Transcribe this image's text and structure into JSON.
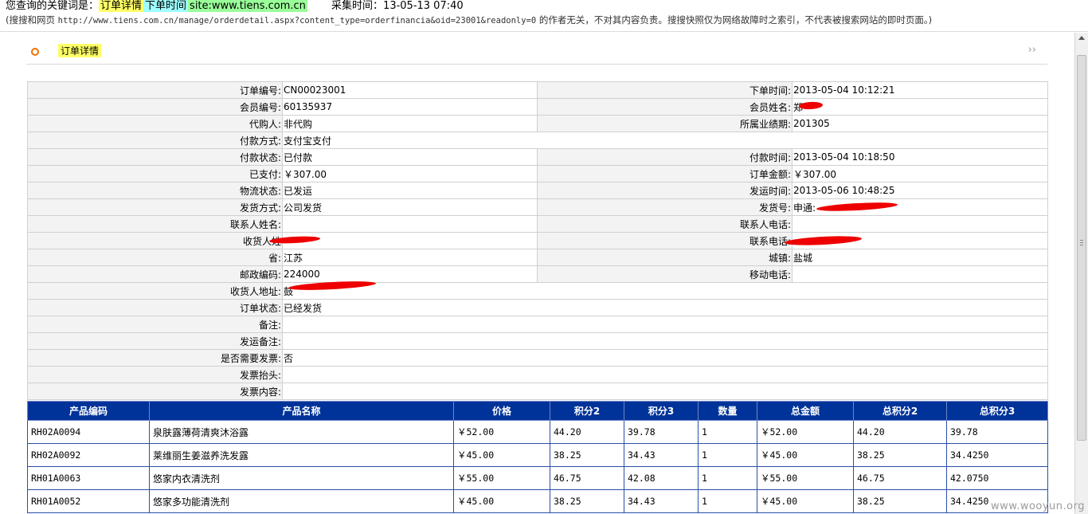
{
  "snapshot": {
    "keyword_prefix": "您查询的关键词是：",
    "keywords": [
      "订单详情",
      "下单时间",
      "site:www.tiens.com.cn"
    ],
    "collect_label": "采集时间：",
    "collect_time": "13-05-13 07:40",
    "notice_prefix": "(搜搜和网页",
    "url": "http://www.tiens.com.cn/manage/orderdetail.aspx?content_type=orderfinancia&oid=23001&readonly=0",
    "notice_suffix": "的作者无关，不对其内容负责。搜搜快照仅为网络故障时之索引，不代表被搜索网站的即时页面。)"
  },
  "page": {
    "title": "订单详情",
    "more": "››"
  },
  "detail": {
    "order_no": {
      "label": "订单编号:",
      "value": "CN00023001"
    },
    "order_time": {
      "label": "下单时间:",
      "value": "2013-05-04 10:12:21"
    },
    "member_no": {
      "label": "会员编号:",
      "value": "60135937"
    },
    "member_name": {
      "label": "会员姓名:",
      "value": "郑"
    },
    "agent": {
      "label": "代购人:",
      "value": "非代购"
    },
    "period": {
      "label": "所属业绩期:",
      "value": "201305"
    },
    "pay_method": {
      "label": "付款方式:",
      "value": "支付宝支付"
    },
    "pay_status": {
      "label": "付款状态:",
      "value": "已付款"
    },
    "pay_time": {
      "label": "付款时间:",
      "value": "2013-05-04 10:18:50"
    },
    "paid": {
      "label": "已支付:",
      "value": "￥307.00"
    },
    "order_amount": {
      "label": "订单金额:",
      "value": "￥307.00"
    },
    "logistics_status": {
      "label": "物流状态:",
      "value": "已发运"
    },
    "ship_time": {
      "label": "发运时间:",
      "value": "2013-05-06 10:48:25"
    },
    "ship_method": {
      "label": "发货方式:",
      "value": "公司发货"
    },
    "ship_no": {
      "label": "发货号:",
      "value": "申通:"
    },
    "contact_name": {
      "label": "联系人姓名:",
      "value": ""
    },
    "contact_phone": {
      "label": "联系人电话:",
      "value": ""
    },
    "receiver_name": {
      "label": "收货人姓",
      "value": ""
    },
    "receiver_phone": {
      "label": "联系电话:",
      "value": ""
    },
    "province": {
      "label": "省:",
      "value": "江苏"
    },
    "city": {
      "label": "城镇:",
      "value": "盐城"
    },
    "postcode": {
      "label": "邮政编码:",
      "value": "224000"
    },
    "mobile": {
      "label": "移动电话:",
      "value": ""
    },
    "address": {
      "label": "收货人地址:",
      "value": "鼓"
    },
    "order_status": {
      "label": "订单状态:",
      "value": "已经发货"
    },
    "remark": {
      "label": "备注:",
      "value": ""
    },
    "ship_remark": {
      "label": "发运备注:",
      "value": ""
    },
    "need_invoice": {
      "label": "是否需要发票:",
      "value": "否"
    },
    "invoice_title": {
      "label": "发票抬头:",
      "value": ""
    },
    "invoice_content": {
      "label": "发票内容:",
      "value": ""
    }
  },
  "products": {
    "headers": [
      "产品编码",
      "产品名称",
      "价格",
      "积分2",
      "积分3",
      "数量",
      "总金额",
      "总积分2",
      "总积分3"
    ],
    "rows": [
      [
        "RH02A0094",
        "泉肤露薄荷清爽沐浴露",
        "￥52.00",
        "44.20",
        "39.78",
        "1",
        "￥52.00",
        "44.20",
        "39.78"
      ],
      [
        "RH02A0092",
        "莱维丽生姜滋养洗发露",
        "￥45.00",
        "38.25",
        "34.43",
        "1",
        "￥45.00",
        "38.25",
        "34.4250"
      ],
      [
        "RH01A0063",
        "悠家内衣清洗剂",
        "￥55.00",
        "46.75",
        "42.08",
        "1",
        "￥55.00",
        "46.75",
        "42.0750"
      ],
      [
        "RH01A0052",
        "悠家多功能清洗剂",
        "￥45.00",
        "38.25",
        "34.43",
        "1",
        "￥45.00",
        "38.25",
        "34.4250"
      ]
    ]
  },
  "watermark": "www.wooyun.org",
  "colors": {
    "header_blue": "#003399",
    "keyword_yellow": "#ffff66",
    "redact_red": "#ee0000"
  }
}
